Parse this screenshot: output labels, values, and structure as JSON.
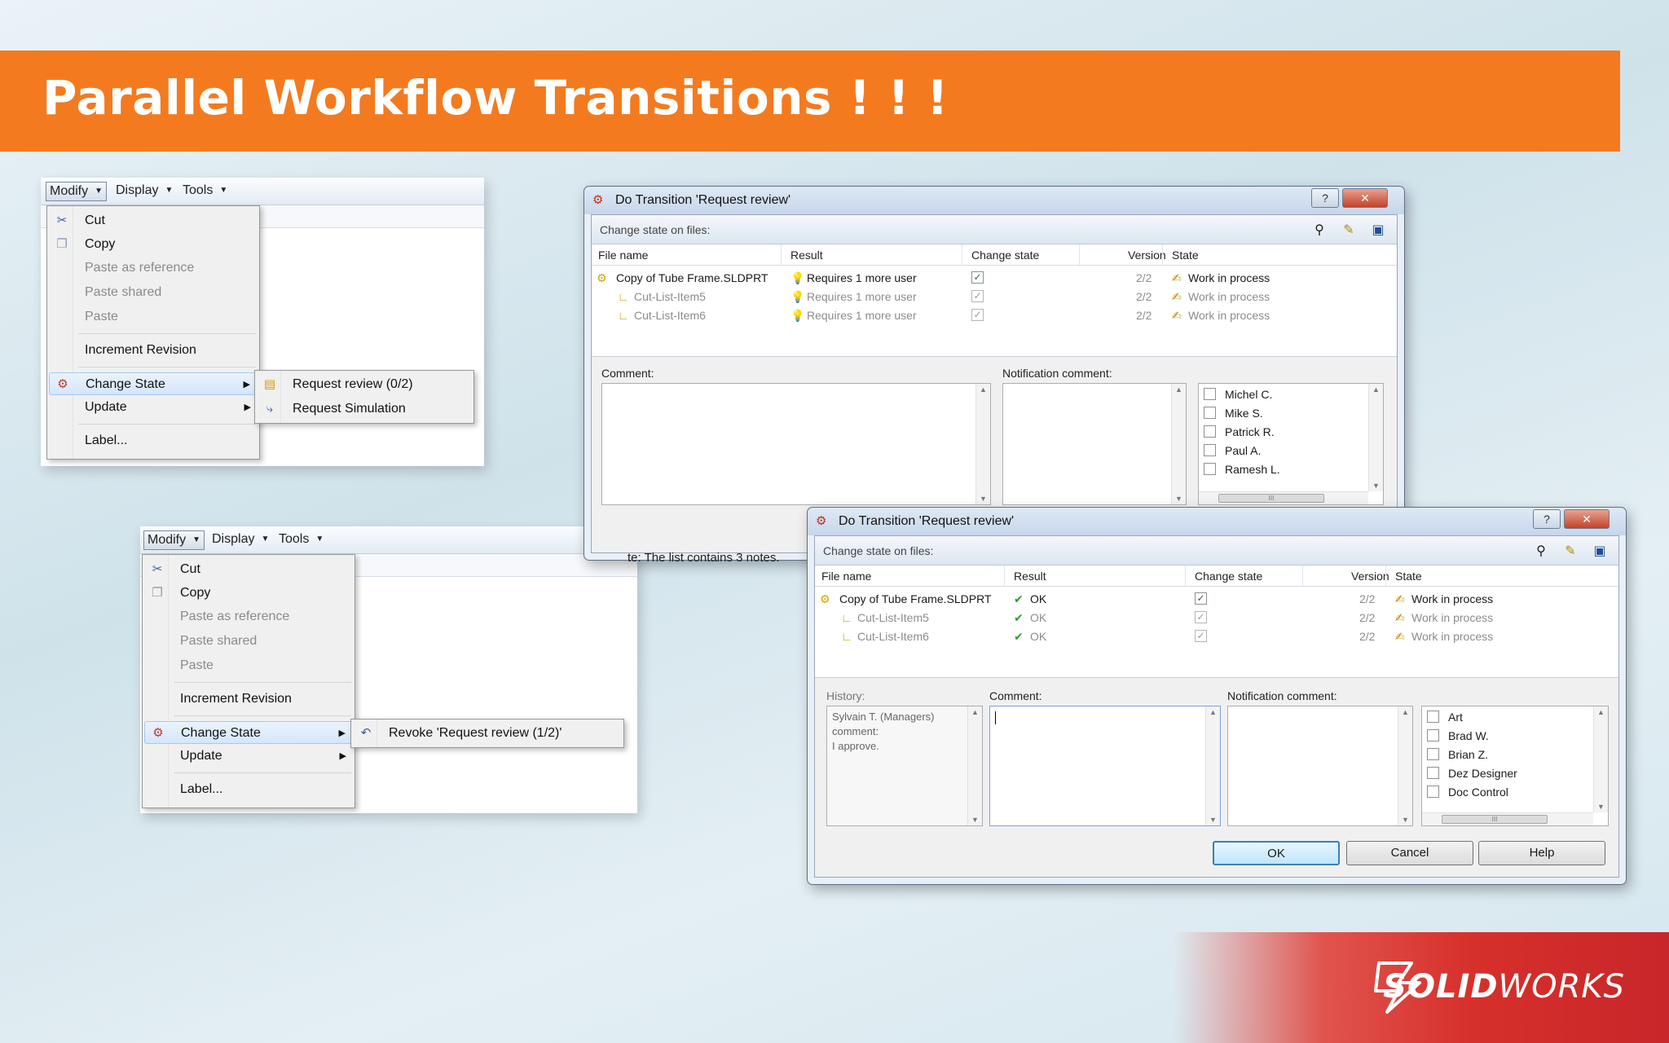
{
  "slide": {
    "title": "Parallel Workflow Transitions ! ! !"
  },
  "menubar": {
    "modify": "Modify",
    "display": "Display",
    "tools": "Tools"
  },
  "context_menu": {
    "cut": "Cut",
    "copy": "Copy",
    "paste_as_reference": "Paste as reference",
    "paste_shared": "Paste shared",
    "paste": "Paste",
    "increment_revision": "Increment Revision",
    "change_state": "Change State",
    "update": "Update",
    "label": "Label..."
  },
  "flyout_top": {
    "items": [
      "Request review (0/2)",
      "Request Simulation"
    ]
  },
  "flyout_bottom": {
    "items": [
      "Revoke 'Request review (1/2)'"
    ]
  },
  "dialog": {
    "title": "Do Transition 'Request review'",
    "section_label": "Change state on files:",
    "columns": {
      "file_name": "File name",
      "result": "Result",
      "change_state": "Change state",
      "version": "Version",
      "state": "State"
    },
    "comment_label": "Comment:",
    "notification_label": "Notification comment:",
    "history_label": "History:"
  },
  "dialog1": {
    "rows": [
      {
        "file": "Copy of Tube Frame.SLDPRT",
        "result": "Requires 1 more user",
        "version": "2/2",
        "state": "Work in process"
      },
      {
        "file": "Cut-List-Item5",
        "result": "Requires 1 more user",
        "version": "2/2",
        "state": "Work in process"
      },
      {
        "file": "Cut-List-Item6",
        "result": "Requires 1 more user",
        "version": "2/2",
        "state": "Work in process"
      }
    ],
    "users": [
      "Michel C.",
      "Mike S.",
      "Patrick R.",
      "Paul A.",
      "Ramesh L."
    ],
    "note": "te: The list contains 3 notes."
  },
  "dialog2": {
    "rows": [
      {
        "file": "Copy of Tube Frame.SLDPRT",
        "result": "OK",
        "version": "2/2",
        "state": "Work in process"
      },
      {
        "file": "Cut-List-Item5",
        "result": "OK",
        "version": "2/2",
        "state": "Work in process"
      },
      {
        "file": "Cut-List-Item6",
        "result": "OK",
        "version": "2/2",
        "state": "Work in process"
      }
    ],
    "history_text": [
      "Sylvain T. (Managers)",
      "comment:",
      "I approve."
    ],
    "users": [
      "Art",
      "Brad W.",
      "Brian Z.",
      "Dez Designer",
      "Doc Control"
    ],
    "buttons": {
      "ok": "OK",
      "cancel": "Cancel",
      "help": "Help"
    }
  },
  "scroll_thumb_label": "III",
  "brand": {
    "name_bold": "SOLID",
    "name_light": "WORKS"
  },
  "colors": {
    "banner": "#f47a1f",
    "brand_red": "#d7302b",
    "ok_green": "#2e9b2e"
  },
  "icons": [
    "cut-icon",
    "copy-icon",
    "change-state-icon",
    "request-review-icon",
    "request-simulation-icon",
    "revoke-icon",
    "filter-icon",
    "edit-icon",
    "save-icon",
    "help-icon",
    "close-icon",
    "part-icon",
    "cut-list-icon",
    "bulb-icon",
    "check-icon",
    "state-icon",
    "solidworks-logo"
  ]
}
